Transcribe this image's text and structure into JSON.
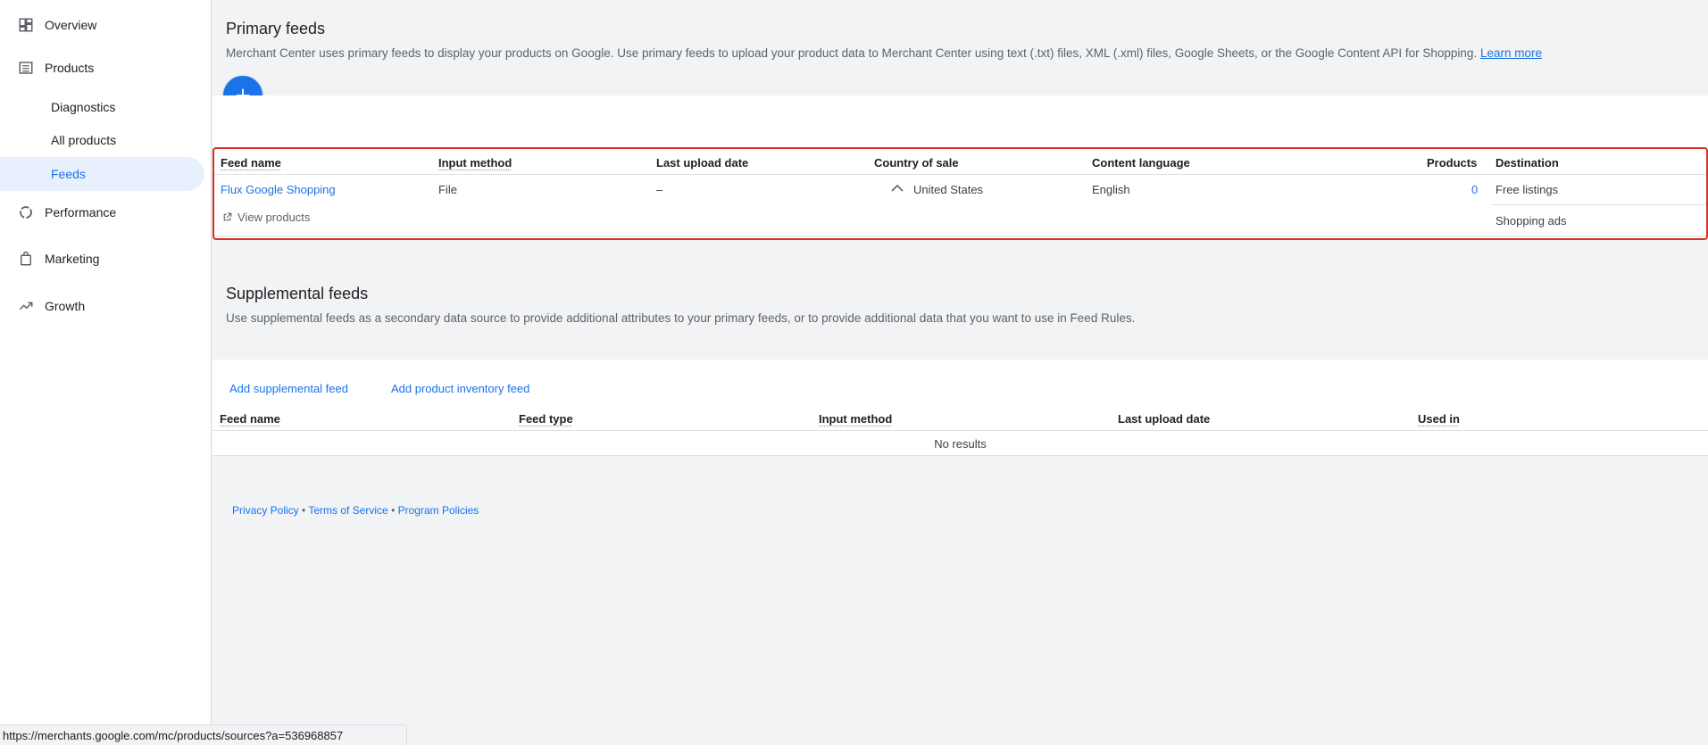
{
  "sidebar": {
    "items": [
      {
        "label": "Overview",
        "icon": "dashboard-icon"
      },
      {
        "label": "Products",
        "icon": "list-icon"
      },
      {
        "label": "Performance",
        "icon": "donut-icon"
      },
      {
        "label": "Marketing",
        "icon": "bag-icon"
      },
      {
        "label": "Growth",
        "icon": "trending-up-icon"
      }
    ],
    "sub_items": [
      {
        "label": "Diagnostics"
      },
      {
        "label": "All products"
      },
      {
        "label": "Feeds",
        "active": true
      }
    ]
  },
  "primary": {
    "title": "Primary feeds",
    "description": "Merchant Center uses primary feeds to display your products on Google. Use primary feeds to upload your product data to Merchant Center using text (.txt) files, XML (.xml) files, Google Sheets, or the Google Content API for Shopping.",
    "learn_more": "Learn more",
    "columns": [
      "Feed name",
      "Input method",
      "Last upload date",
      "Country of sale",
      "Content language",
      "Products",
      "Destination"
    ],
    "row": {
      "feed_name": "Flux Google Shopping",
      "input_method": "File",
      "last_upload": "–",
      "country": "United States",
      "language": "English",
      "products": "0",
      "destinations": [
        "Free listings",
        "Shopping ads"
      ],
      "view_products": "View products"
    }
  },
  "supplemental": {
    "title": "Supplemental feeds",
    "description": "Use supplemental feeds as a secondary data source to provide additional attributes to your primary feeds, or to provide additional data that you want to use in Feed Rules.",
    "add_supplemental": "Add supplemental feed",
    "add_inventory": "Add product inventory feed",
    "columns": [
      "Feed name",
      "Feed type",
      "Input method",
      "Last upload date",
      "Used in"
    ],
    "empty": "No results"
  },
  "footer": {
    "privacy": "Privacy Policy",
    "terms": "Terms of Service",
    "policies": "Program Policies",
    "sep": "•"
  },
  "status_url": "https://merchants.google.com/mc/products/sources?a=536968857",
  "colors": {
    "accent": "#1a73e8",
    "highlight_border": "#d93025",
    "active_bg": "#e8f0fe"
  }
}
